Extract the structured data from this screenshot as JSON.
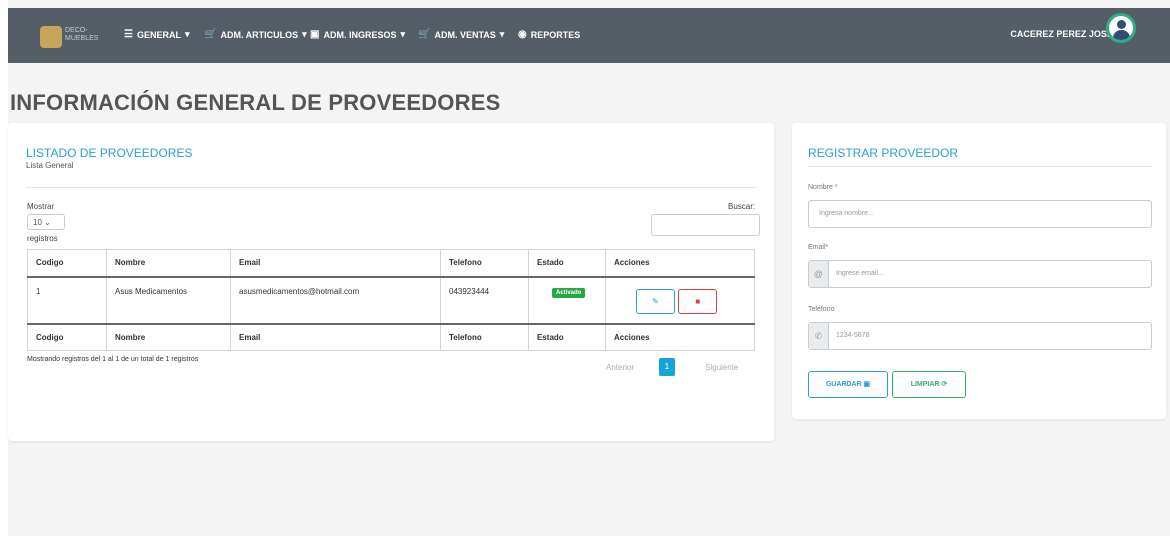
{
  "brand": {
    "logo_text": "DECO-MUEBLES"
  },
  "nav": {
    "general": "GENERAL",
    "articulos": "ADM. ARTICULOS",
    "ingresos": "ADM. INGRESOS",
    "ventas": "ADM. VENTAS",
    "reportes": "REPORTES",
    "user": "CACEREZ PEREZ JOSE"
  },
  "icons": {
    "general": "list-plus-icon",
    "cart": "cart-icon",
    "box": "archive-icon",
    "eye": "eye-icon",
    "caret": "caret-down-icon",
    "avatar": "user-avatar-icon",
    "email": "at-icon",
    "phone": "phone-icon",
    "save": "save-icon",
    "refresh": "refresh-icon",
    "edit": "edit-icon",
    "delete": "trash-icon"
  },
  "page": {
    "title": "INFORMACIÓN GENERAL DE PROVEEDORES"
  },
  "listing": {
    "title": "LISTADO DE PROVEEDORES",
    "subtitle": "Lista General",
    "show_label": "Mostrar",
    "page_size": "10",
    "records_label": "registros",
    "search_label": "Buscar:",
    "columns": [
      "Codigo",
      "Nombre",
      "Email",
      "Telefono",
      "Estado",
      "Acciones"
    ],
    "rows": [
      {
        "codigo": "1",
        "nombre": "Asus Medicamentos",
        "email": "asusmedicamentos@hotmail.com",
        "telefono": "043923444",
        "estado": "Activado"
      }
    ],
    "info": "Mostrando registros del 1 al 1 de un total de 1 registros",
    "prev": "Anterior",
    "current_page": "1",
    "next": "Siguiente"
  },
  "form": {
    "title": "REGISTRAR PROVEEDOR",
    "name_label": "Nombre *",
    "name_placeholder": "Ingresa nombre...",
    "email_label": "Email*",
    "email_placeholder": "Ingrese email...",
    "phone_label": "Teléfono",
    "phone_placeholder": "1234-5678",
    "save_label": "GUARDAR",
    "clear_label": "LIMPIAR"
  },
  "colors": {
    "topbar": "#555e67",
    "accent": "#2a9fd6",
    "success": "#28a745",
    "danger": "#e03d3d"
  }
}
